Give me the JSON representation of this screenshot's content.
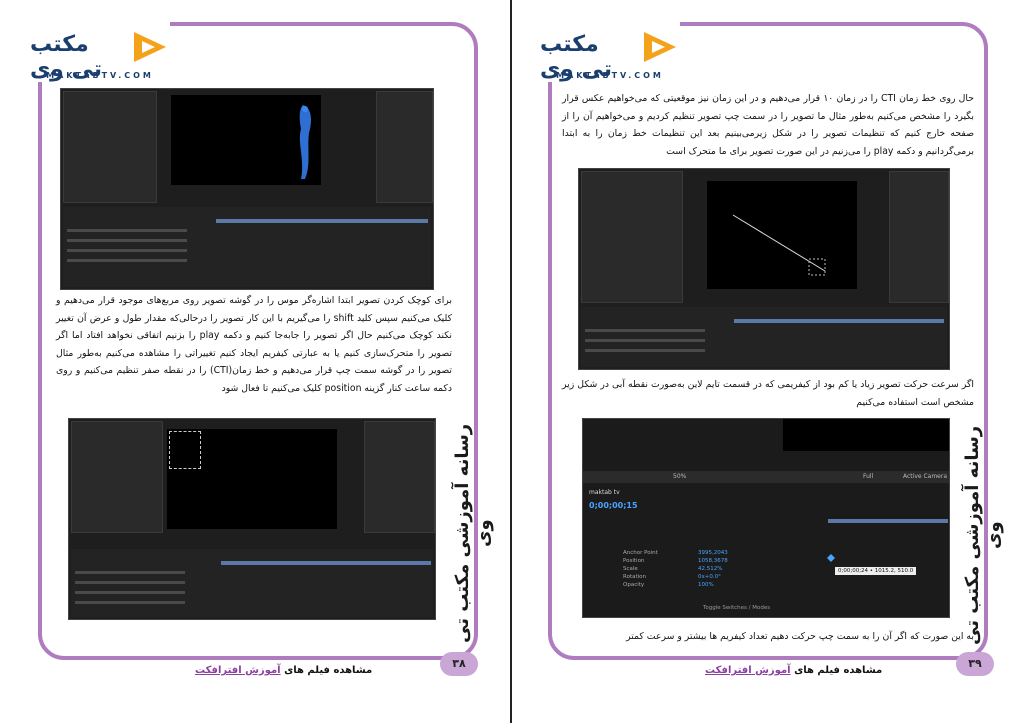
{
  "brand": {
    "name": "مکتب تی وی",
    "site": "MAKTABTV.COM"
  },
  "spine_title": "رسانه آموزشی مکتب تی وی",
  "left_page": {
    "page_number": "۳۸",
    "paragraph": "برای کوچک کردن تصویر ابتدا اشاره‌گر موس را در گوشه تصویر روی مربع‌های موجود قرار می‌دهیم و کلیک می‌کنیم سپس کلید shift را می‌گیریم با این کار تصویر را درحالی‌که مقدار طول و عرض آن تغییر نکند کوچک می‌کنیم حال اگر تصویر را جابه‌جا کنیم و دکمه play را بزنیم اتفاقی نخواهد افتاد اما اگر تصویر را متحرک‌سازی کنیم یا به عبارتی کیفریم ایجاد کنیم تغییراتی را مشاهده می‌کنیم به‌طور مثال تصویر را در گوشه سمت چپ قرار می‌دهیم و خط زمان(CTI) را در نقطه صفر تنظیم می‌کنیم و روی دکمه ساعت کنار گزینه position کلیک می‌کنیم تا فعال شود"
  },
  "right_page": {
    "page_number": "۳۹",
    "paragraph_top": "حال روی خط زمان CTI را در زمان ۱۰ قرار می‌دهیم و در این زمان نیز موقعیتی که می‌خواهیم عکس قرار بگیرد را مشخص می‌کنیم به‌طور مثال ما تصویر را در سمت چپ تصویر تنظیم کردیم و می‌خواهیم آن را از صفحه خارج کنیم که تنظیمات تصویر را در شکل زیرمی‌بینیم بعد این تنظیمات خط زمان را به ابتدا برمی‌گردانیم و دکمه play را می‌زنیم در این صورت تصویر برای ما متحرک است",
    "paragraph_mid": "اگر سرعت حرکت تصویر زیاد یا کم بود از کیفریمی که در قسمت تایم لاین به‌صورت نقطه آبی در شکل زیر مشخص است استفاده می‌کنیم",
    "paragraph_bottom": "به این صورت که اگر آن را به سمت چپ حرکت دهیم تعداد کیفریم ها بیشتر و سرعت کمتر",
    "ae_labels": {
      "timecode": "0;00;00;15",
      "comp_tab": "maktab tv",
      "layers": [
        "Anchor Point",
        "Position",
        "Scale",
        "Rotation",
        "Opacity"
      ],
      "values": [
        "3995,2043",
        "1058,3678",
        "42.512%",
        "0x+0.0°",
        "100%"
      ],
      "zoom": "50%",
      "view": "Full",
      "camera": "Active Camera",
      "tooltip": "0;00;00;24 • 1015.2, 510.0",
      "toggle": "Toggle Switches / Modes"
    }
  },
  "footer": {
    "prefix": "مشاهده فیلم های",
    "link": "آموزش افترافکت"
  },
  "colors": {
    "frame": "#b07cc0",
    "brand": "#1a3f6e",
    "accent": "#f5a21b",
    "link": "#8b3fa0"
  }
}
